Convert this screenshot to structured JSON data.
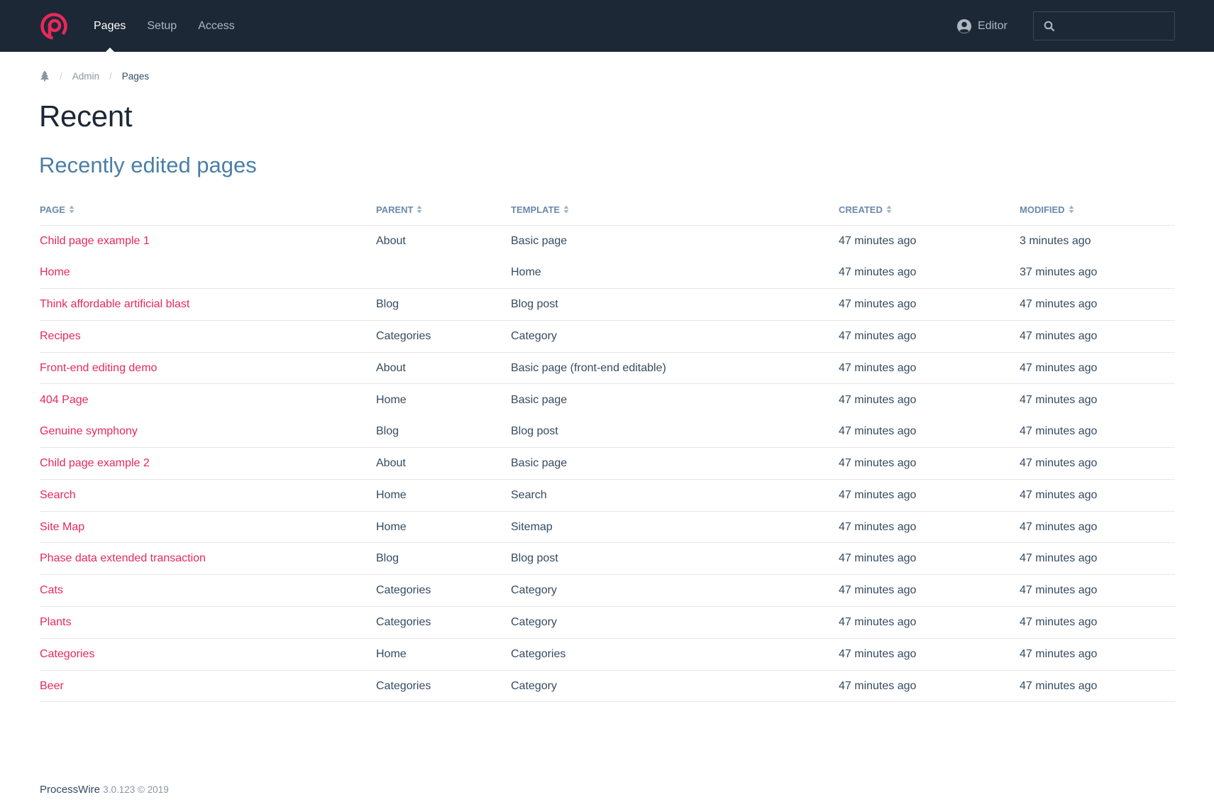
{
  "header": {
    "nav": [
      {
        "label": "Pages",
        "active": true
      },
      {
        "label": "Setup",
        "active": false
      },
      {
        "label": "Access",
        "active": false
      }
    ],
    "user_label": "Editor",
    "search_placeholder": ""
  },
  "breadcrumb": {
    "items": [
      "Admin",
      "Pages"
    ]
  },
  "page_title": "Recent",
  "section_title": "Recently edited pages",
  "table": {
    "columns": [
      "PAGE",
      "PARENT",
      "TEMPLATE",
      "CREATED",
      "MODIFIED"
    ],
    "rows": [
      {
        "page": "Child page example 1",
        "parent": "About",
        "template": "Basic page",
        "created": "47 minutes ago",
        "modified": "3 minutes ago"
      },
      {
        "page": "Home",
        "parent": "",
        "template": "Home",
        "created": "47 minutes ago",
        "modified": "37 minutes ago"
      },
      {
        "page": "Think affordable artificial blast",
        "parent": "Blog",
        "template": "Blog post",
        "created": "47 minutes ago",
        "modified": "47 minutes ago"
      },
      {
        "page": "Recipes",
        "parent": "Categories",
        "template": "Category",
        "created": "47 minutes ago",
        "modified": "47 minutes ago"
      },
      {
        "page": "Front-end editing demo",
        "parent": "About",
        "template": "Basic page (front-end editable)",
        "created": "47 minutes ago",
        "modified": "47 minutes ago"
      },
      {
        "page": "404 Page",
        "parent": "Home",
        "template": "Basic page",
        "created": "47 minutes ago",
        "modified": "47 minutes ago"
      },
      {
        "page": "Genuine symphony",
        "parent": "Blog",
        "template": "Blog post",
        "created": "47 minutes ago",
        "modified": "47 minutes ago"
      },
      {
        "page": "Child page example 2",
        "parent": "About",
        "template": "Basic page",
        "created": "47 minutes ago",
        "modified": "47 minutes ago"
      },
      {
        "page": "Search",
        "parent": "Home",
        "template": "Search",
        "created": "47 minutes ago",
        "modified": "47 minutes ago"
      },
      {
        "page": "Site Map",
        "parent": "Home",
        "template": "Sitemap",
        "created": "47 minutes ago",
        "modified": "47 minutes ago"
      },
      {
        "page": "Phase data extended transaction",
        "parent": "Blog",
        "template": "Blog post",
        "created": "47 minutes ago",
        "modified": "47 minutes ago"
      },
      {
        "page": "Cats",
        "parent": "Categories",
        "template": "Category",
        "created": "47 minutes ago",
        "modified": "47 minutes ago"
      },
      {
        "page": "Plants",
        "parent": "Categories",
        "template": "Category",
        "created": "47 minutes ago",
        "modified": "47 minutes ago"
      },
      {
        "page": "Categories",
        "parent": "Home",
        "template": "Categories",
        "created": "47 minutes ago",
        "modified": "47 minutes ago"
      },
      {
        "page": "Beer",
        "parent": "Categories",
        "template": "Category",
        "created": "47 minutes ago",
        "modified": "47 minutes ago"
      }
    ]
  },
  "footer": {
    "product": "ProcessWire",
    "version": "3.0.123 © 2019"
  },
  "colors": {
    "masthead": "#1c2836",
    "brand": "#e8295a",
    "link": "#e8295a",
    "section_title": "#4a7fa7",
    "header_text": "#6a8aab"
  },
  "icons": {
    "logo": "processwire-logo-icon",
    "user": "user-circle-icon",
    "search": "search-icon",
    "home": "tree-icon",
    "sort": "sort-icon"
  }
}
